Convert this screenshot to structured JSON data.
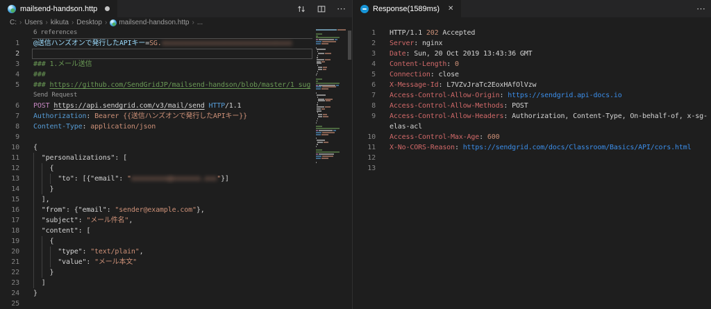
{
  "icons": {
    "breadcrumb_separator": "›",
    "close": "✕",
    "more_actions": "⋯",
    "left_editor_actions": [
      "compare-changes-icon",
      "split-editor-icon",
      "more-actions-icon"
    ],
    "file_icon": "http-file-icon",
    "response_icon": "rest-client-response-icon"
  },
  "colors": {
    "editor_bg": "#1e1e1e",
    "tabbar_bg": "#252526",
    "token_string": "#ce9178",
    "token_comment": "#6a9955",
    "token_keyword": "#c586c0",
    "token_type": "#569cd6",
    "token_variable": "#9cdcfe",
    "token_header_name": "#d16969",
    "token_link": "#3b8eea",
    "line_number": "#858585"
  },
  "left_pane": {
    "tab": {
      "title": "mailsend-handson.http",
      "dirty": true
    },
    "breadcrumb": {
      "items": [
        {
          "label": "C:"
        },
        {
          "label": "Users"
        },
        {
          "label": "kikuta"
        },
        {
          "label": "Desktop"
        },
        {
          "label": "mailsend-handson.http",
          "icon": "http-file-icon"
        },
        {
          "label": "..."
        }
      ]
    },
    "rows": [
      {
        "lens": true,
        "name": "references-codelens",
        "t": [
          [
            "c-lens",
            "6 references"
          ]
        ]
      },
      {
        "n": "1",
        "t": [
          [
            "c-var",
            "@送信ハンズオンで発行したAPIキー"
          ],
          [
            "c-def",
            "="
          ],
          [
            "c-str",
            "SG."
          ],
          [
            "c-str blur",
            "xxxxxxxxxxxxxxxxxxxxxxxxxxxxxxxx"
          ]
        ]
      },
      {
        "n": "2",
        "cur": true,
        "t": []
      },
      {
        "n": "3",
        "t": [
          [
            "c-com",
            "### 1.メール送信"
          ]
        ]
      },
      {
        "n": "4",
        "t": [
          [
            "c-com",
            "###"
          ]
        ]
      },
      {
        "n": "5",
        "t": [
          [
            "c-com",
            "### "
          ],
          [
            "c-com u",
            "https://github.com/SendGridJP/mailsend-handson/blob/master/1_sug"
          ]
        ]
      },
      {
        "lens": true,
        "name": "send-request-codelens",
        "t": [
          [
            "c-lens",
            "Send Request"
          ]
        ]
      },
      {
        "n": "6",
        "t": [
          [
            "c-kw",
            "POST"
          ],
          [
            "c-def",
            " "
          ],
          [
            "c-def u",
            "https://api.sendgrid.com/v3/mail/send"
          ],
          [
            "c-def",
            " "
          ],
          [
            "c-type",
            "HTTP"
          ],
          [
            "c-def",
            "/1.1"
          ]
        ]
      },
      {
        "n": "7",
        "t": [
          [
            "c-type",
            "Authorization"
          ],
          [
            "c-def",
            ": "
          ],
          [
            "c-str",
            "Bearer {{送信ハンズオンで発行したAPIキー}}"
          ]
        ]
      },
      {
        "n": "8",
        "t": [
          [
            "c-type",
            "Content-Type"
          ],
          [
            "c-def",
            ": "
          ],
          [
            "c-str",
            "application/json"
          ]
        ]
      },
      {
        "n": "9",
        "t": []
      },
      {
        "n": "10",
        "t": [
          [
            "c-def",
            "{"
          ]
        ]
      },
      {
        "n": "11",
        "t": [
          [
            "c-def",
            "  \"personalizations\": ["
          ]
        ]
      },
      {
        "n": "12",
        "t": [
          [
            "c-def",
            "    {"
          ]
        ]
      },
      {
        "n": "13",
        "t": [
          [
            "c-def",
            "      \"to\": [{\"email\": "
          ],
          [
            "c-str",
            "\""
          ],
          [
            "c-str blur",
            "xxxxxxxxx@xxxxxxx.xxx"
          ],
          [
            "c-str",
            "\""
          ],
          [
            "c-def",
            "}]"
          ]
        ]
      },
      {
        "n": "14",
        "t": [
          [
            "c-def",
            "    }"
          ]
        ]
      },
      {
        "n": "15",
        "t": [
          [
            "c-def",
            "  ],"
          ]
        ]
      },
      {
        "n": "16",
        "t": [
          [
            "c-def",
            "  \"from\": {\"email\": "
          ],
          [
            "c-str",
            "\"sender@example.com\""
          ],
          [
            "c-def",
            "},"
          ]
        ]
      },
      {
        "n": "17",
        "t": [
          [
            "c-def",
            "  \"subject\": "
          ],
          [
            "c-str",
            "\"メール件名\""
          ],
          [
            "c-def",
            ","
          ]
        ]
      },
      {
        "n": "18",
        "t": [
          [
            "c-def",
            "  \"content\": ["
          ]
        ]
      },
      {
        "n": "19",
        "t": [
          [
            "c-def",
            "    {"
          ]
        ]
      },
      {
        "n": "20",
        "t": [
          [
            "c-def",
            "      \"type\": "
          ],
          [
            "c-str",
            "\"text/plain\""
          ],
          [
            "c-def",
            ","
          ]
        ]
      },
      {
        "n": "21",
        "t": [
          [
            "c-def",
            "      \"value\": "
          ],
          [
            "c-str",
            "\"メール本文\""
          ]
        ]
      },
      {
        "n": "22",
        "t": [
          [
            "c-def",
            "    }"
          ]
        ]
      },
      {
        "n": "23",
        "t": [
          [
            "c-def",
            "  ]"
          ]
        ]
      },
      {
        "n": "24",
        "t": [
          [
            "c-def",
            "}"
          ]
        ]
      },
      {
        "n": "25",
        "t": []
      }
    ],
    "minimap": [
      [
        [
          0,
          30,
          "v"
        ],
        [
          31,
          12,
          "o"
        ]
      ],
      null,
      [
        [
          0,
          9,
          "g"
        ]
      ],
      [
        [
          0,
          3,
          "g"
        ]
      ],
      [
        [
          0,
          34,
          "g"
        ]
      ],
      [
        [
          0,
          3,
          "m"
        ],
        [
          4,
          22,
          "w"
        ],
        [
          27,
          4,
          "b"
        ]
      ],
      [
        [
          0,
          8,
          "b"
        ],
        [
          9,
          20,
          "o"
        ]
      ],
      [
        [
          0,
          7,
          "b"
        ],
        [
          8,
          10,
          "o"
        ]
      ],
      null,
      [
        [
          0,
          1,
          "w"
        ]
      ],
      [
        [
          1,
          13,
          "w"
        ]
      ],
      [
        [
          2,
          1,
          "w"
        ]
      ],
      [
        [
          3,
          9,
          "w"
        ],
        [
          13,
          9,
          "o"
        ]
      ],
      [
        [
          2,
          1,
          "w"
        ]
      ],
      [
        [
          1,
          2,
          "w"
        ]
      ],
      [
        [
          1,
          11,
          "w"
        ],
        [
          13,
          8,
          "o"
        ]
      ],
      [
        [
          1,
          6,
          "w"
        ],
        [
          8,
          5,
          "o"
        ]
      ],
      [
        [
          1,
          7,
          "w"
        ]
      ],
      [
        [
          2,
          1,
          "w"
        ]
      ],
      [
        [
          3,
          6,
          "w"
        ],
        [
          10,
          6,
          "o"
        ]
      ],
      [
        [
          3,
          6,
          "w"
        ],
        [
          10,
          5,
          "o"
        ]
      ],
      [
        [
          2,
          1,
          "w"
        ]
      ],
      [
        [
          1,
          1,
          "w"
        ]
      ],
      [
        [
          0,
          1,
          "w"
        ]
      ],
      null,
      [
        [
          0,
          9,
          "g"
        ]
      ],
      [
        [
          0,
          3,
          "g"
        ]
      ],
      [
        [
          0,
          34,
          "g"
        ]
      ],
      [
        [
          0,
          3,
          "m"
        ],
        [
          4,
          24,
          "w"
        ],
        [
          29,
          4,
          "b"
        ]
      ],
      [
        [
          0,
          8,
          "b"
        ],
        [
          9,
          20,
          "o"
        ]
      ],
      [
        [
          0,
          7,
          "b"
        ],
        [
          8,
          10,
          "o"
        ]
      ],
      null,
      [
        [
          0,
          1,
          "w"
        ]
      ],
      [
        [
          1,
          13,
          "w"
        ]
      ],
      [
        [
          2,
          1,
          "w"
        ]
      ],
      [
        [
          3,
          9,
          "w"
        ],
        [
          13,
          11,
          "o"
        ]
      ],
      [
        [
          3,
          10,
          "w"
        ],
        [
          14,
          7,
          "o"
        ]
      ],
      [
        [
          2,
          1,
          "w"
        ]
      ],
      [
        [
          1,
          2,
          "w"
        ]
      ],
      [
        [
          1,
          11,
          "w"
        ],
        [
          13,
          8,
          "o"
        ]
      ],
      [
        [
          1,
          6,
          "w"
        ],
        [
          8,
          5,
          "o"
        ]
      ],
      [
        [
          1,
          7,
          "w"
        ]
      ],
      [
        [
          2,
          1,
          "w"
        ]
      ],
      [
        [
          3,
          6,
          "w"
        ],
        [
          10,
          6,
          "o"
        ]
      ],
      [
        [
          3,
          6,
          "w"
        ],
        [
          10,
          8,
          "o"
        ]
      ],
      [
        [
          2,
          1,
          "w"
        ]
      ],
      [
        [
          1,
          1,
          "w"
        ]
      ],
      [
        [
          0,
          1,
          "w"
        ]
      ],
      null,
      [
        [
          0,
          9,
          "g"
        ]
      ],
      [
        [
          0,
          34,
          "g"
        ]
      ],
      [
        [
          0,
          3,
          "m"
        ],
        [
          4,
          20,
          "w"
        ],
        [
          25,
          4,
          "b"
        ]
      ],
      [
        [
          0,
          8,
          "b"
        ],
        [
          9,
          18,
          "o"
        ]
      ],
      [
        [
          0,
          7,
          "b"
        ],
        [
          8,
          10,
          "o"
        ]
      ],
      null,
      [
        [
          0,
          1,
          "w"
        ]
      ],
      [
        [
          1,
          12,
          "w"
        ]
      ],
      [
        [
          2,
          8,
          "w"
        ],
        [
          11,
          7,
          "o"
        ]
      ],
      [
        [
          1,
          2,
          "w"
        ]
      ],
      [
        [
          0,
          1,
          "w"
        ]
      ],
      null,
      [
        [
          0,
          9,
          "g"
        ]
      ],
      [
        [
          0,
          34,
          "g"
        ]
      ],
      [
        [
          0,
          3,
          "m"
        ],
        [
          4,
          22,
          "w"
        ]
      ],
      [
        [
          0,
          8,
          "b"
        ],
        [
          9,
          16,
          "o"
        ]
      ],
      [
        [
          0,
          7,
          "b"
        ],
        [
          8,
          10,
          "o"
        ]
      ],
      null,
      [
        [
          0,
          1,
          "w"
        ]
      ],
      null
    ]
  },
  "right_pane": {
    "tab": {
      "title": "Response(1589ms)"
    },
    "rows": [
      {
        "n": "1",
        "t": [
          [
            "c-def",
            "HTTP/1.1 "
          ],
          [
            "c-num",
            "202"
          ],
          [
            "c-def",
            " Accepted"
          ]
        ]
      },
      {
        "n": "2",
        "t": [
          [
            "c-hdr",
            "Server"
          ],
          [
            "c-def",
            ": nginx"
          ]
        ]
      },
      {
        "n": "3",
        "t": [
          [
            "c-hdr",
            "Date"
          ],
          [
            "c-def",
            ": Sun, 20 Oct 2019 13:43:36 GMT"
          ]
        ]
      },
      {
        "n": "4",
        "t": [
          [
            "c-hdr",
            "Content-Length"
          ],
          [
            "c-def",
            ": "
          ],
          [
            "c-num",
            "0"
          ]
        ]
      },
      {
        "n": "5",
        "t": [
          [
            "c-hdr",
            "Connection"
          ],
          [
            "c-def",
            ": close"
          ]
        ]
      },
      {
        "n": "6",
        "t": [
          [
            "c-hdr",
            "X-Message-Id"
          ],
          [
            "c-def",
            ": L7VZvJraTc2EoxHAfOlVzw"
          ]
        ]
      },
      {
        "n": "7",
        "t": [
          [
            "c-hdr",
            "Access-Control-Allow-Origin"
          ],
          [
            "c-def",
            ": "
          ],
          [
            "c-url",
            "https://sendgrid.api-docs.io"
          ]
        ]
      },
      {
        "n": "8",
        "t": [
          [
            "c-hdr",
            "Access-Control-Allow-Methods"
          ],
          [
            "c-def",
            ": POST"
          ]
        ]
      },
      {
        "n": "9",
        "t": [
          [
            "c-hdr",
            "Access-Control-Allow-Headers"
          ],
          [
            "c-def",
            ": Authorization, Content-Type, On-behalf-of, x-sg-"
          ]
        ]
      },
      {
        "n": "",
        "t": [
          [
            "c-def",
            "elas-acl"
          ]
        ]
      },
      {
        "n": "10",
        "t": [
          [
            "c-hdr",
            "Access-Control-Max-Age"
          ],
          [
            "c-def",
            ": "
          ],
          [
            "c-num",
            "600"
          ]
        ]
      },
      {
        "n": "11",
        "t": [
          [
            "c-hdr",
            "X-No-CORS-Reason"
          ],
          [
            "c-def",
            ": "
          ],
          [
            "c-url",
            "https://sendgrid.com/docs/Classroom/Basics/API/cors.html"
          ]
        ]
      },
      {
        "n": "12",
        "t": []
      },
      {
        "n": "13",
        "t": []
      }
    ]
  }
}
